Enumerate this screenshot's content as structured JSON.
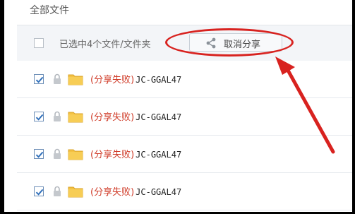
{
  "breadcrumb": "全部文件",
  "toolbar": {
    "selection_text": "已选中4个文件/文件夹",
    "cancel_share_label": "取消分享"
  },
  "colors": {
    "annotation": "#d8221f",
    "fail_text": "#d03d2a",
    "folder": "#f4c243",
    "checkbox_check": "#2f6fba"
  },
  "files": [
    {
      "status": "(分享失败)",
      "name": "JC-GGAL47",
      "checked": true
    },
    {
      "status": "(分享失败)",
      "name": "JC-GGAL47",
      "checked": true
    },
    {
      "status": "(分享失败)",
      "name": "JC-GGAL47",
      "checked": true
    },
    {
      "status": "(分享失败)",
      "name": "JC-GGAL47",
      "checked": true
    }
  ],
  "icons": {
    "share": "share-icon",
    "lock": "lock-icon",
    "folder": "folder-icon",
    "check": "checkmark-icon"
  }
}
